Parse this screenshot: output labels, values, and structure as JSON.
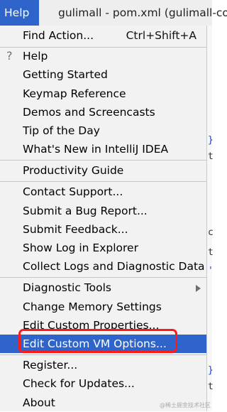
{
  "menubar": {
    "help_label": "Help"
  },
  "window": {
    "title": "gulimall - pom.xml (gulimall-co"
  },
  "menu": {
    "find_action": {
      "label": "Find Action...",
      "shortcut": "Ctrl+Shift+A"
    },
    "help": "Help",
    "getting_started": "Getting Started",
    "keymap_reference": "Keymap Reference",
    "demos": "Demos and Screencasts",
    "tip_of_day": "Tip of the Day",
    "whats_new": "What's New in IntelliJ IDEA",
    "productivity_guide": "Productivity Guide",
    "contact_support": "Contact Support...",
    "submit_bug": "Submit a Bug Report...",
    "submit_feedback": "Submit Feedback...",
    "show_log": "Show Log in Explorer",
    "collect_logs": "Collect Logs and Diagnostic Data",
    "diagnostic_tools": "Diagnostic Tools",
    "change_memory": "Change Memory Settings",
    "edit_custom_properties": "Edit Custom Properties...",
    "edit_custom_vm": "Edit Custom VM Options...",
    "register": "Register...",
    "check_updates": "Check for Updates...",
    "about": "About"
  },
  "icons": {
    "help": "question-mark-icon",
    "submenu": "chevron-right-icon"
  },
  "colors": {
    "selection": "#2f65ca",
    "highlight_border": "#ff1a1a"
  },
  "watermark": "@稀土掘金技术社区"
}
